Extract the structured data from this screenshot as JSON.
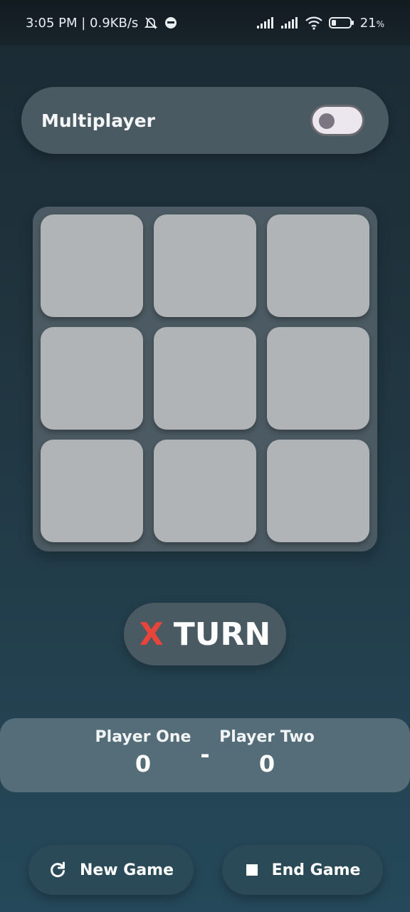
{
  "status_bar": {
    "time_speed": "3:05 PM | 0.9KB/s",
    "battery": "21"
  },
  "mode": {
    "label": "Multiplayer",
    "enabled": false
  },
  "board": {
    "cells": [
      "",
      "",
      "",
      "",
      "",
      "",
      "",
      "",
      ""
    ]
  },
  "turn": {
    "symbol": "X",
    "text": "TURN"
  },
  "scoreboard": {
    "player_one": {
      "name": "Player One",
      "score": "0"
    },
    "separator": "-",
    "player_two": {
      "name": "Player Two",
      "score": "0"
    }
  },
  "buttons": {
    "new_game": "New Game",
    "end_game": "End Game"
  },
  "colors": {
    "x_color": "#e8443a",
    "cell_color": "#b0b4b7",
    "panel_color": "#4a5a62"
  },
  "icons": {
    "new_game": "refresh-icon",
    "end_game": "stop-icon"
  }
}
